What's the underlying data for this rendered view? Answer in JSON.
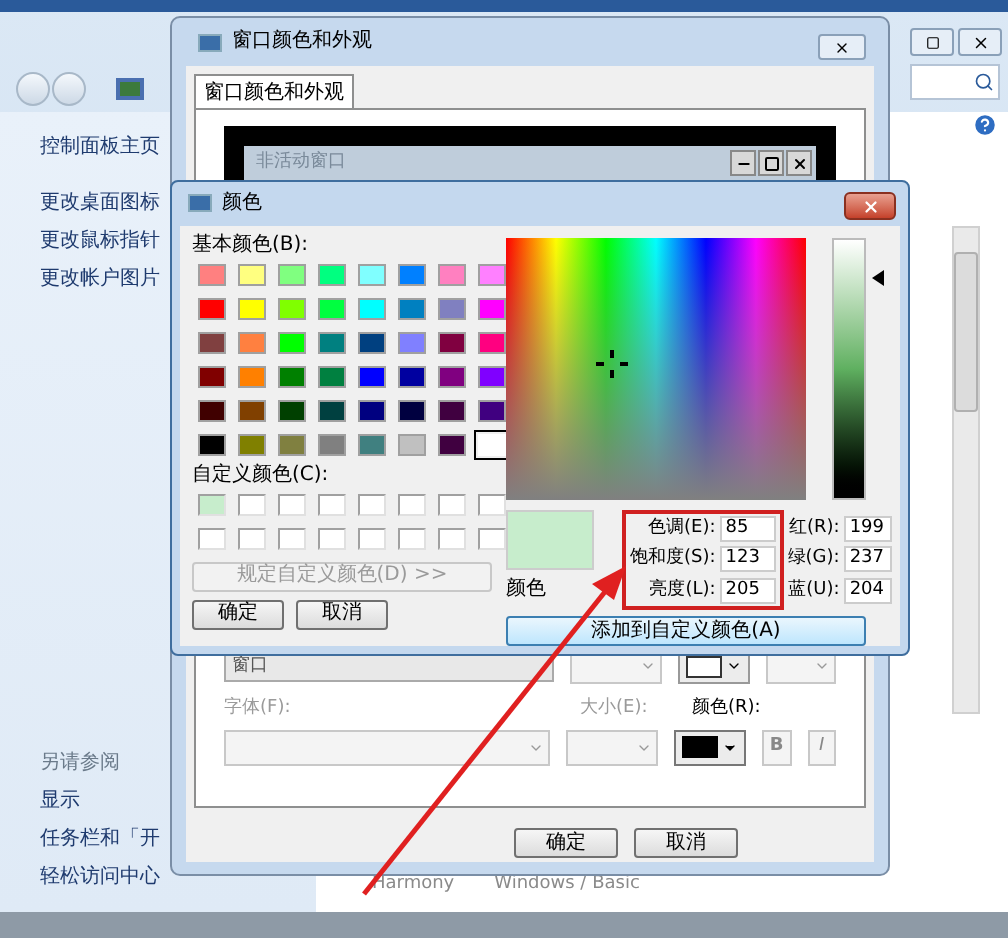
{
  "explorer": {
    "sidebar_links": [
      "控制面板主页",
      "更改桌面图标",
      "更改鼠标指针",
      "更改帐户图片"
    ],
    "see_also_title": "另请参阅",
    "see_also_links": [
      "显示",
      "任务栏和「开",
      "轻松访问中心"
    ],
    "theme_labels": [
      "Harmony",
      "Windows / Basic"
    ]
  },
  "appearance_dialog": {
    "title": "窗口颜色和外观",
    "tabs": [
      {
        "label": "窗口颜色和外观",
        "selected": true
      }
    ],
    "inactive_title": "非活动窗口",
    "item_value": "窗口",
    "font_label": "字体(F):",
    "size_label": "大小(E):",
    "color_label": "颜色(R):",
    "bold_button": "B",
    "italic_button": "I",
    "buttons": [
      "确定",
      "取消"
    ]
  },
  "color_dialog": {
    "title": "颜色",
    "basic_label": "基本颜色(B):",
    "basic_colors": [
      {
        "color": "#ff8080",
        "selected": false
      },
      {
        "color": "#ffff80",
        "selected": false
      },
      {
        "color": "#80ff80",
        "selected": false
      },
      {
        "color": "#00ff80",
        "selected": false
      },
      {
        "color": "#80ffff",
        "selected": false
      },
      {
        "color": "#0080ff",
        "selected": false
      },
      {
        "color": "#ff80c0",
        "selected": false
      },
      {
        "color": "#ff80ff",
        "selected": false
      },
      {
        "color": "#ff0000",
        "selected": false
      },
      {
        "color": "#ffff00",
        "selected": false
      },
      {
        "color": "#80ff00",
        "selected": false
      },
      {
        "color": "#00ff40",
        "selected": false
      },
      {
        "color": "#00ffff",
        "selected": false
      },
      {
        "color": "#0080c0",
        "selected": false
      },
      {
        "color": "#8080c0",
        "selected": false
      },
      {
        "color": "#ff00ff",
        "selected": false
      },
      {
        "color": "#804040",
        "selected": false
      },
      {
        "color": "#ff8040",
        "selected": false
      },
      {
        "color": "#00ff00",
        "selected": false
      },
      {
        "color": "#008080",
        "selected": false
      },
      {
        "color": "#004080",
        "selected": false
      },
      {
        "color": "#8080ff",
        "selected": false
      },
      {
        "color": "#800040",
        "selected": false
      },
      {
        "color": "#ff0080",
        "selected": false
      },
      {
        "color": "#800000",
        "selected": false
      },
      {
        "color": "#ff8000",
        "selected": false
      },
      {
        "color": "#008000",
        "selected": false
      },
      {
        "color": "#008040",
        "selected": false
      },
      {
        "color": "#0000ff",
        "selected": false
      },
      {
        "color": "#0000a0",
        "selected": false
      },
      {
        "color": "#800080",
        "selected": false
      },
      {
        "color": "#8000ff",
        "selected": false
      },
      {
        "color": "#400000",
        "selected": false
      },
      {
        "color": "#804000",
        "selected": false
      },
      {
        "color": "#004000",
        "selected": false
      },
      {
        "color": "#004040",
        "selected": false
      },
      {
        "color": "#000080",
        "selected": false
      },
      {
        "color": "#000040",
        "selected": false
      },
      {
        "color": "#400040",
        "selected": false
      },
      {
        "color": "#400080",
        "selected": false
      },
      {
        "color": "#000000",
        "selected": false
      },
      {
        "color": "#808000",
        "selected": false
      },
      {
        "color": "#808040",
        "selected": false
      },
      {
        "color": "#808080",
        "selected": false
      },
      {
        "color": "#408080",
        "selected": false
      },
      {
        "color": "#c0c0c0",
        "selected": false
      },
      {
        "color": "#400040",
        "selected": false
      },
      {
        "color": "#ffffff",
        "selected": true
      }
    ],
    "custom_label": "自定义颜色(C):",
    "custom_colors": [
      {
        "filled": true,
        "color": "#c7edcc"
      },
      {
        "filled": false
      },
      {
        "filled": false
      },
      {
        "filled": false
      },
      {
        "filled": false
      },
      {
        "filled": false
      },
      {
        "filled": false
      },
      {
        "filled": false
      },
      {
        "filled": false
      },
      {
        "filled": false
      },
      {
        "filled": false
      },
      {
        "filled": false
      },
      {
        "filled": false
      },
      {
        "filled": false
      },
      {
        "filled": false
      },
      {
        "filled": false
      }
    ],
    "define_button": {
      "label": "规定自定义颜色(D) >>",
      "disabled": true
    },
    "buttons": [
      "确定",
      "取消"
    ],
    "luminance": {
      "level": 0.85
    },
    "preview_label": "颜色",
    "hsl_fields": [
      {
        "label": "色调(E):",
        "value": "85"
      },
      {
        "label": "饱和度(S):",
        "value": "123"
      },
      {
        "label": "亮度(L):",
        "value": "205"
      }
    ],
    "rgb_fields": [
      {
        "label": "红(R):",
        "value": "199"
      },
      {
        "label": "绿(G):",
        "value": "237"
      },
      {
        "label": "蓝(U):",
        "value": "204"
      }
    ],
    "add_button": "添加到自定义颜色(A)"
  }
}
